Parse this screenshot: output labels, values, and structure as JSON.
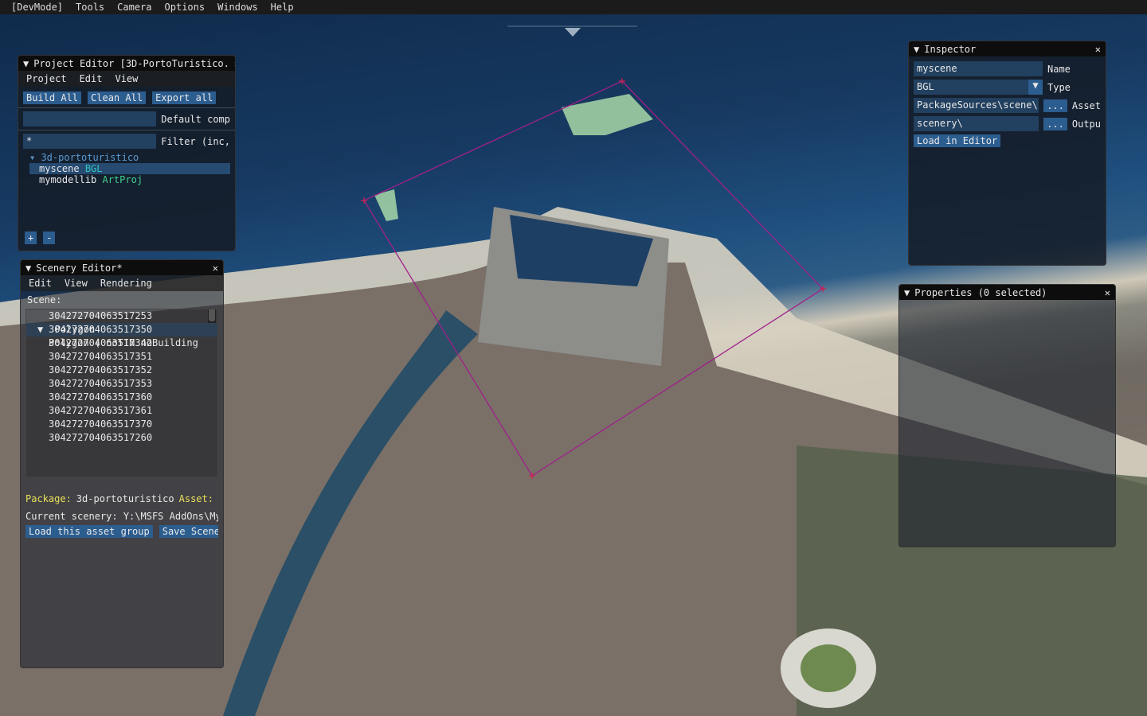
{
  "menubar": [
    "[DevMode]",
    "Tools",
    "Camera",
    "Options",
    "Windows",
    "Help"
  ],
  "project_editor": {
    "title": "Project Editor [3D-PortoTuristico.",
    "menu": [
      "Project",
      "Edit",
      "View"
    ],
    "buttons": [
      "Build All",
      "Clean All",
      "Export all"
    ],
    "default_label": "Default comp",
    "filter_value": "*",
    "filter_label": "Filter (inc,",
    "tree_root": "3d-portoturistico",
    "items": [
      {
        "name": "myscene",
        "type": "BGL"
      },
      {
        "name": "mymodellib",
        "type": "ArtProj"
      }
    ],
    "add": "+",
    "remove": "-"
  },
  "scenery_editor": {
    "title": "Scenery Editor*",
    "menu": [
      "Edit",
      "View",
      "Rendering"
    ],
    "scene_label": "Scene:",
    "ids": [
      "304272704063517253",
      "304272704063517350",
      "304272704063517342",
      "304272704063517351",
      "304272704063517352",
      "304272704063517353",
      "304272704063517360",
      "304272704063517361",
      "304272704063517370",
      "304272704063517260"
    ],
    "group": "Polygon",
    "group_item": "Polygon  ( noTIN noBuilding",
    "package_label": "Package:",
    "package_value": "3d-portoturistico",
    "asset_label": "Asset:",
    "current_scenery": "Current scenery: Y:\\MSFS AddOns\\MyF",
    "load_button": "Load this asset group",
    "save_button": "Save Scener"
  },
  "inspector": {
    "title": "Inspector",
    "name_value": "myscene",
    "name_label": "Name",
    "type_value": "BGL",
    "type_label": "Type",
    "asset_value": "PackageSources\\scene\\",
    "asset_label": "Asset",
    "output_value": "scenery\\",
    "output_label": "Outpu",
    "browse": "...",
    "load_button": "Load in Editor"
  },
  "properties": {
    "title": "Properties (0 selected)"
  },
  "colors": {
    "polygon": "#a0208a",
    "button": "#2c5d8f"
  }
}
